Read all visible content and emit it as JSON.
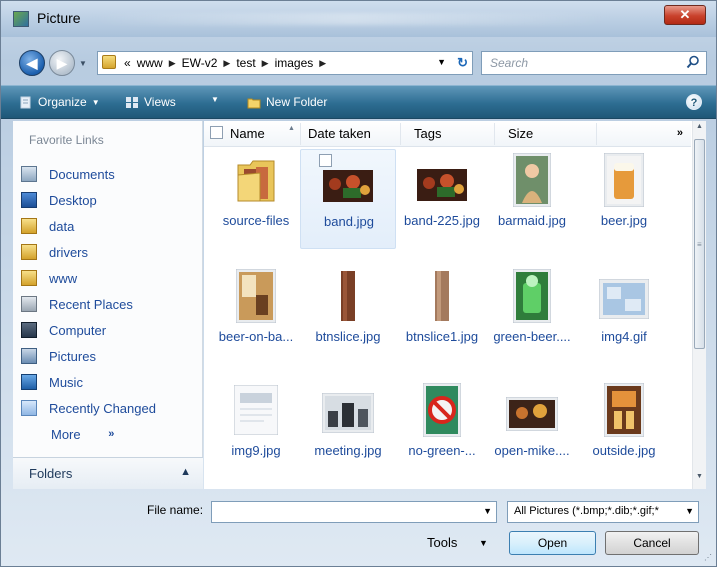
{
  "window": {
    "title": "Picture",
    "close_label": "✕"
  },
  "nav": {
    "back_symbol": "◀",
    "forward_symbol": "▶"
  },
  "address": {
    "prefix": "«",
    "crumbs": [
      "www",
      "EW-v2",
      "test",
      "images"
    ],
    "search_placeholder": "Search"
  },
  "toolbar": {
    "organize": "Organize",
    "views": "Views",
    "new_folder": "New Folder",
    "help": "?"
  },
  "sidebar": {
    "title": "Favorite Links",
    "items": [
      {
        "label": "Documents",
        "icon": "documents-icon"
      },
      {
        "label": "Desktop",
        "icon": "desktop-icon"
      },
      {
        "label": "data",
        "icon": "folder-icon"
      },
      {
        "label": "drivers",
        "icon": "folder-icon"
      },
      {
        "label": "www",
        "icon": "folder-icon"
      },
      {
        "label": "Recent Places",
        "icon": "recent-places-icon"
      },
      {
        "label": "Computer",
        "icon": "computer-icon"
      },
      {
        "label": "Pictures",
        "icon": "pictures-icon"
      },
      {
        "label": "Music",
        "icon": "music-icon"
      },
      {
        "label": "Recently Changed",
        "icon": "recently-changed-icon"
      }
    ],
    "more": "More",
    "more_arrows": "»",
    "folders": "Folders",
    "folders_chevron": "▲"
  },
  "columns": {
    "name": "Name",
    "date_taken": "Date taken",
    "tags": "Tags",
    "size": "Size",
    "more": "»"
  },
  "files": [
    {
      "name": "source-files",
      "kind": "folder"
    },
    {
      "name": "band.jpg",
      "kind": "photo-band"
    },
    {
      "name": "band-225.jpg",
      "kind": "photo-band"
    },
    {
      "name": "barmaid.jpg",
      "kind": "photo-portrait"
    },
    {
      "name": "beer.jpg",
      "kind": "photo-beer"
    },
    {
      "name": "beer-on-ba...",
      "kind": "photo-bar"
    },
    {
      "name": "btnslice.jpg",
      "kind": "slice"
    },
    {
      "name": "btnslice1.jpg",
      "kind": "slice-light"
    },
    {
      "name": "green-beer....",
      "kind": "photo-green"
    },
    {
      "name": "img4.gif",
      "kind": "gif"
    },
    {
      "name": "img9.jpg",
      "kind": "doc"
    },
    {
      "name": "meeting.jpg",
      "kind": "photo-meeting"
    },
    {
      "name": "no-green-...",
      "kind": "photo-nogreen"
    },
    {
      "name": "open-mike....",
      "kind": "photo-mike"
    },
    {
      "name": "outside.jpg",
      "kind": "photo-outside"
    }
  ],
  "footer": {
    "file_name_label": "File name:",
    "file_name_value": "",
    "filter": "All Pictures (*.bmp;*.dib;*.gif;*",
    "tools": "Tools",
    "open": "Open",
    "cancel": "Cancel"
  }
}
